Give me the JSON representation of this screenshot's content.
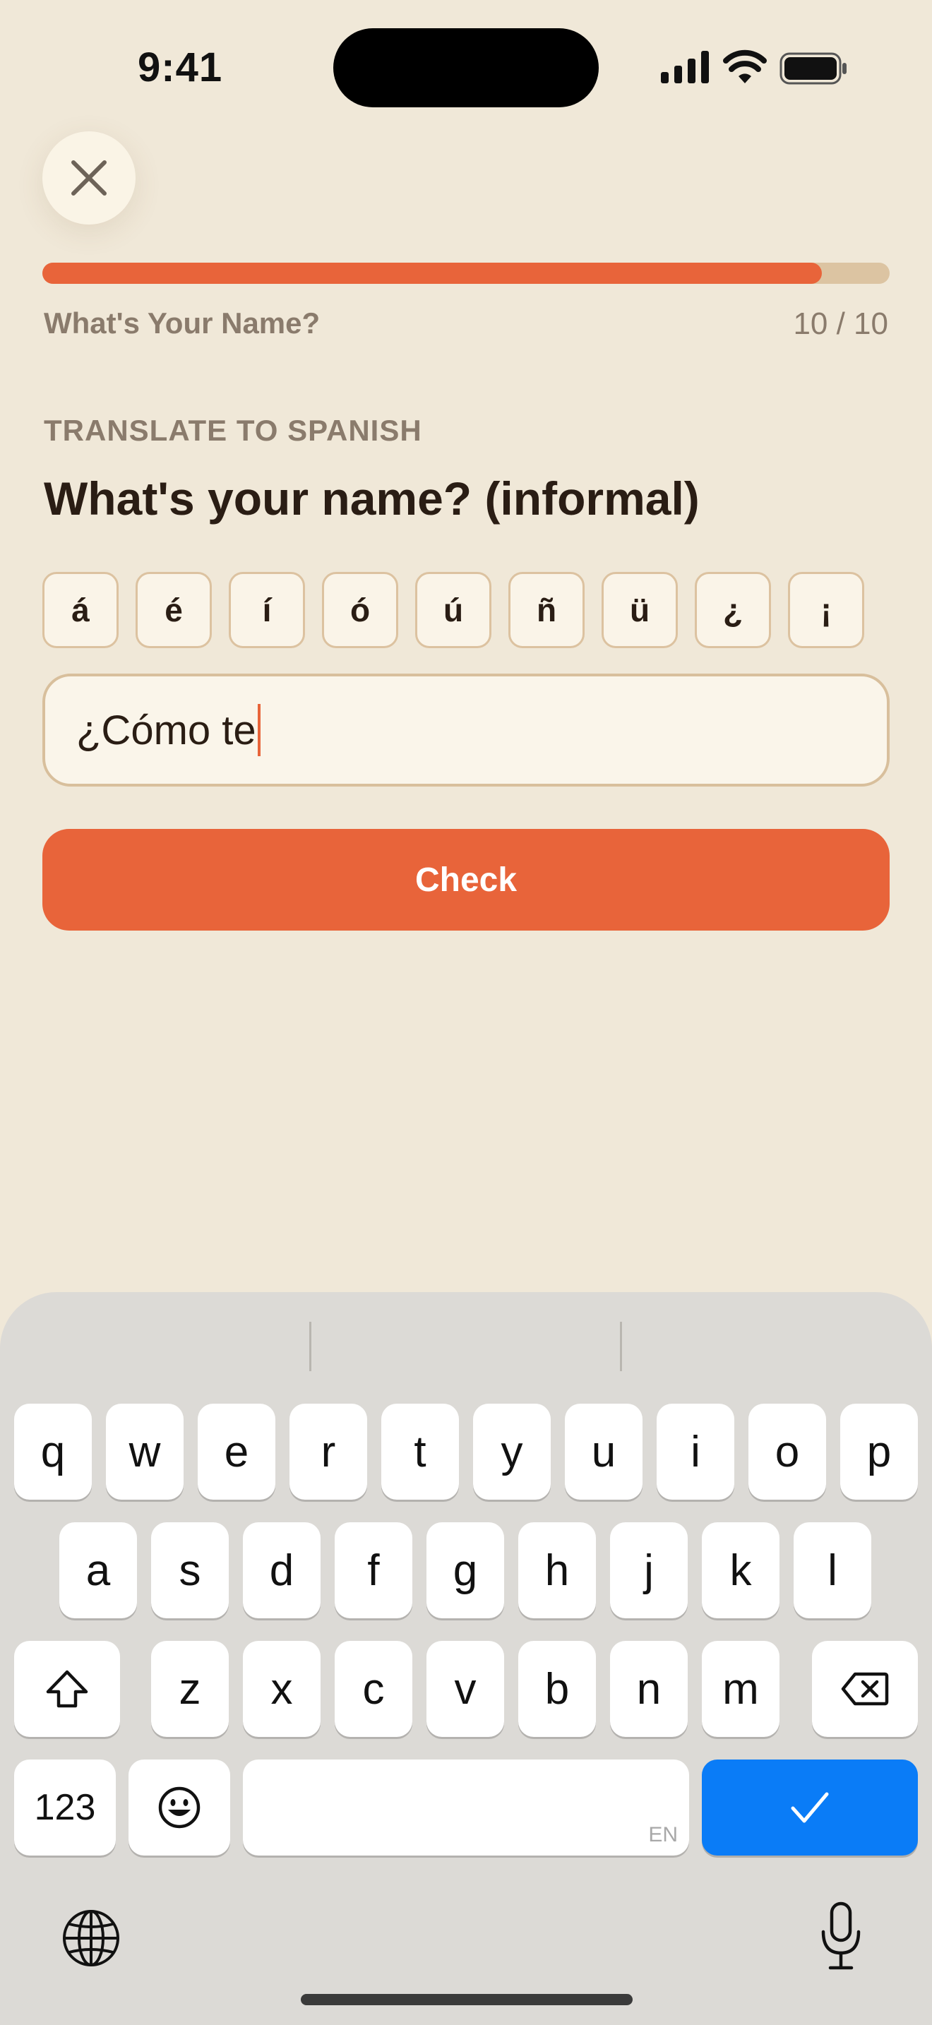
{
  "status_bar": {
    "time": "9:41"
  },
  "header": {
    "lesson_title": "What's Your Name?",
    "progress_text": "10 / 10",
    "progress_fraction": 0.92
  },
  "exercise": {
    "instruction": "TRANSLATE TO SPANISH",
    "prompt": "What's your name? (informal)",
    "accent_keys": [
      "á",
      "é",
      "í",
      "ó",
      "ú",
      "ñ",
      "ü",
      "¿",
      "¡"
    ],
    "answer_value": "¿Cómo te",
    "check_label": "Check"
  },
  "keyboard": {
    "row1": [
      "q",
      "w",
      "e",
      "r",
      "t",
      "y",
      "u",
      "i",
      "o",
      "p"
    ],
    "row2": [
      "a",
      "s",
      "d",
      "f",
      "g",
      "h",
      "j",
      "k",
      "l"
    ],
    "row3": [
      "z",
      "x",
      "c",
      "v",
      "b",
      "n",
      "m"
    ],
    "numbers_label": "123",
    "space_lang": "EN",
    "done_symbol": "✓"
  },
  "colors": {
    "accent": "#e8643a",
    "background": "#f0e8d8",
    "keyboard_done": "#0a7cf7"
  }
}
